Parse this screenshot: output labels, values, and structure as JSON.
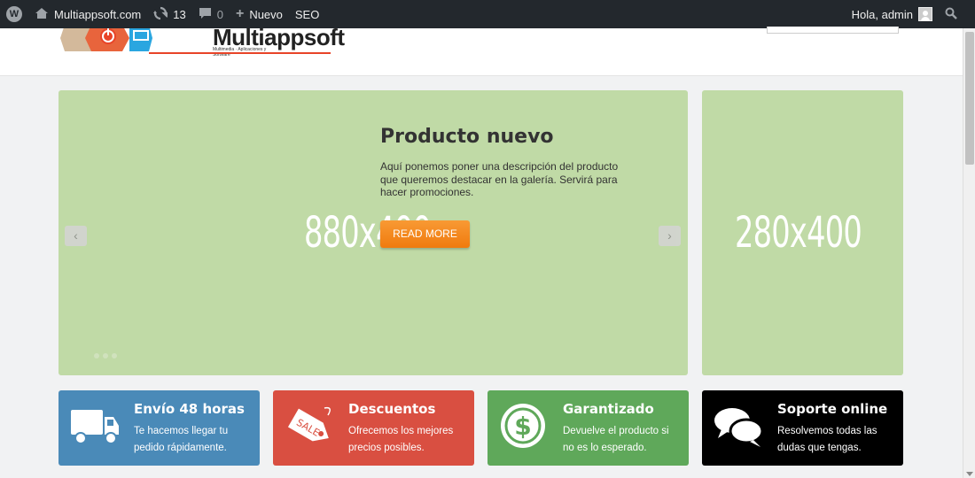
{
  "adminbar": {
    "site_name": "Multiappsoft.com",
    "updates_count": "13",
    "comments_count": "0",
    "new_label": "Nuevo",
    "seo_label": "SEO",
    "greeting": "Hola, admin"
  },
  "header": {
    "logo_text": "Multiappsoft",
    "logo_subtitle": "Multimedia · Aplicaciones y Software"
  },
  "slider": {
    "placeholder": "880x400",
    "title": "Producto nuevo",
    "description": "Aquí ponemos poner una descripción del producto que queremos destacar en la galería. Servirá para hacer promociones.",
    "button_label": "READ MORE",
    "prev_label": "‹",
    "next_label": "›"
  },
  "side_banner": {
    "placeholder": "280x400"
  },
  "features": [
    {
      "title": "Envío 48 horas",
      "text": "Te hacemos llegar tu pedido rápidamente.",
      "icon": "truck-icon",
      "color": "#4a8ab8"
    },
    {
      "title": "Descuentos",
      "text": "Ofrecemos los mejores precios posibles.",
      "icon": "sale-tag-icon",
      "color": "#d94f41",
      "icon_text": "SALE"
    },
    {
      "title": "Garantizado",
      "text": "Devuelve el producto si no es lo esperado.",
      "icon": "dollar-icon",
      "color": "#5fa85a"
    },
    {
      "title": "Soporte online",
      "text": "Resolvemos todas las dudas que tengas.",
      "icon": "chat-bubbles-icon",
      "color": "#000000"
    }
  ],
  "colors": {
    "adminbar_bg": "#23282d",
    "placeholder_green": "#c0daa6",
    "button_orange": "#f68b1f"
  }
}
